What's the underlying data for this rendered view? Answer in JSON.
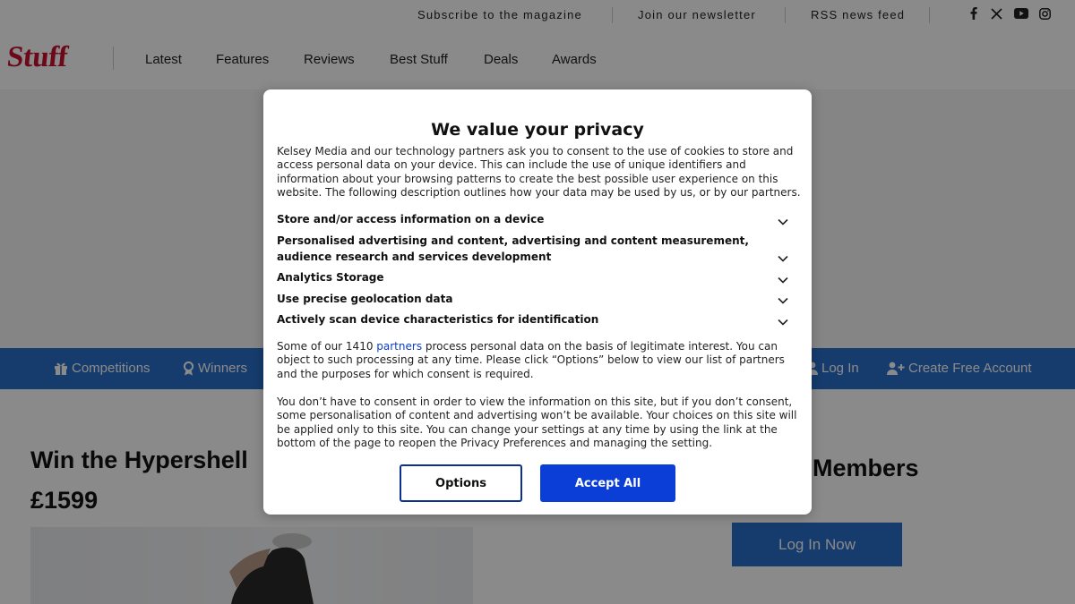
{
  "topbar": {
    "links": [
      "Subscribe to the magazine",
      "Join our newsletter",
      "RSS news feed"
    ],
    "social": [
      "facebook-icon",
      "x-icon",
      "youtube-icon",
      "instagram-icon"
    ]
  },
  "header": {
    "logo": "Stuff",
    "nav": [
      "Latest",
      "Features",
      "Reviews",
      "Best Stuff",
      "Deals",
      "Awards"
    ]
  },
  "secondary_nav": {
    "competitions": "Competitions",
    "winners": "Winners",
    "login": "Log In",
    "create_account": "Create Free Account"
  },
  "main": {
    "article_title_line1": "Win the Hypershell",
    "article_title_line2": "£1599",
    "members_title": "Members",
    "login_now": "Log In Now"
  },
  "consent": {
    "title": "We value your privacy",
    "intro": "Kelsey Media and our technology partners ask you to consent to the use of cookies to store and access personal data on your device. This can include the use of unique identifiers and information about your browsing patterns to create the best possible user experience on this website. The following description outlines how your data may be used by us, or by our partners.",
    "purposes": [
      "Store and/or access information on a device",
      "Personalised advertising and content, advertising and content measurement, audience research and services development",
      "Analytics Storage",
      "Use precise geolocation data",
      "Actively scan device characteristics for identification"
    ],
    "legit_before": "Some of our 1410 ",
    "legit_link": "partners",
    "legit_after": " process personal data on the basis of legitimate interest. You can object to such processing at any time. Please click “Options” below to view our list of partners and the purposes for which consent is required.",
    "no_consent": "You don’t have to consent in order to view the information on this site, but if you don’t consent, some personalisation of content and advertising won’t be available. Your choices on this site will be applied only to this site. You can change your settings at any time by using the link at the bottom of the page to reopen the Privacy Preferences and managing the setting.",
    "options_label": "Options",
    "accept_label": "Accept All"
  },
  "colors": {
    "brand_red": "#c8102e",
    "nav_blue": "#2a6fc9",
    "accept_blue": "#0b3ed6",
    "link_blue": "#0b3ec9"
  }
}
